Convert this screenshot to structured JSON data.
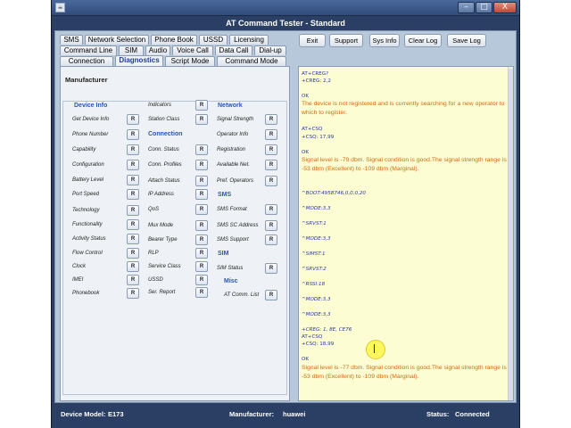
{
  "window": {
    "title": "AT Command Tester - Standard",
    "app_icon": "java-cup-icon",
    "controls": [
      "–",
      "□",
      "X"
    ]
  },
  "tabs_row1": [
    "SMS",
    "Network Selection",
    "Phone Book",
    "USSD",
    "Licensing"
  ],
  "tabs_row2": [
    "Command Line",
    "SIM",
    "Audio",
    "Voice Call",
    "Data Call",
    "Dial-up"
  ],
  "tabs_row3": [
    "Connection",
    "Diagnostics",
    "Script Mode",
    "Command Mode"
  ],
  "active_tab": "Diagnostics",
  "toolbar": {
    "exit": "Exit",
    "support": "Support",
    "sys_info": "Sys Info",
    "clear_log": "Clear Log",
    "save_log": "Save Log"
  },
  "panel_title": "Manufacturer",
  "r_label": "R",
  "col1": {
    "section": "Device Info",
    "items": [
      "Get Device Info",
      "Phone Number",
      "Capability",
      "Configuration",
      "Battery Level",
      "Port Speed",
      "Technology",
      "Functionality",
      "Activity Status",
      "Flow Control",
      "Clock",
      "IMEI",
      "Phonebook"
    ]
  },
  "col2": {
    "items_top": [
      "Indicators",
      "Station Class"
    ],
    "section": "Connection",
    "items": [
      "Conn. Status",
      "Conn. Profiles",
      "Attach Status",
      "IP Address",
      "QoS",
      "Mux Mode",
      "Bearer Type",
      "RLP",
      "Service Class",
      "USSD",
      "Ser. Report"
    ]
  },
  "col3": {
    "section_network": "Network",
    "network_items": [
      "Signal Strength",
      "Operator Info",
      "Registration",
      "Available Net.",
      "Pref. Operators"
    ],
    "section_sms": "SMS",
    "sms_items": [
      "SMS Format",
      "SMS SC Address",
      "SMS Support"
    ],
    "section_sim": "SIM",
    "sim_items": [
      "SIM Status"
    ],
    "section_misc": "Misc",
    "misc_items": [
      "AT Comm. List"
    ]
  },
  "log": {
    "cmd1": "AT+CREG?",
    "resp1": "+CREG: 2,2",
    "ok1": "OK",
    "msg1": "The device is not registered and is currently searching for a new operator to which to register.",
    "cmd2": "AT+CSQ",
    "resp2": "+CSQ: 17,99",
    "ok2": "OK",
    "msg2": "Signal level is -79 dbm. Signal condition is good.The signal strength range is -53 dbm (Excellent) to -109 dbm (Marginal).",
    "u1": "^BOOT:4958746,0,0,0,20",
    "u2": "^MODE:3,3",
    "u3": "^SRVST:1",
    "u4": "^MODE:3,3",
    "u5": "^SIMST:1",
    "u6": "^SRVST:2",
    "u7": "^RSSI:18",
    "u8": "^MODE:3,3",
    "u9": "^MODE:3,3",
    "u10": "+CREG: 1, 8E, CE76",
    "cmd3": "AT+CSQ",
    "resp3": "+CSQ: 18,99",
    "ok3": "OK",
    "msg3": "Signal level is -77 dbm. Signal condition is good.The signal strength range is -53 dbm (Excellent) to -109 dbm (Marginal)."
  },
  "status": {
    "model_label": "Device Model:",
    "model": "E173",
    "manufacturer_label": "Manufacturer:",
    "manufacturer": "huawei",
    "status_label": "Status:",
    "status": "Connected"
  },
  "colors": {
    "frame": "#2a3f63",
    "client": "#b8c8db",
    "log_bg": "#fdfdd3",
    "log_cmd": "#2a36a8",
    "log_msg": "#d26a10",
    "section": "#2a56b8"
  }
}
